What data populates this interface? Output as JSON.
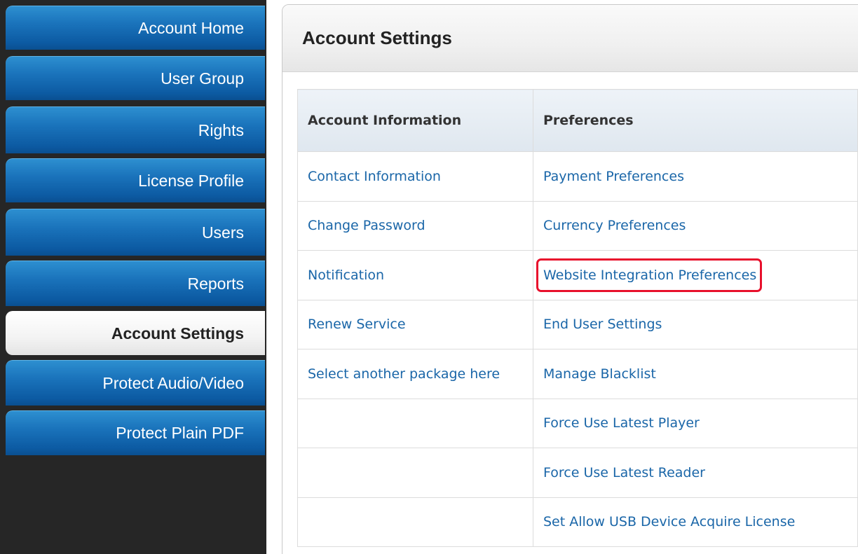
{
  "sidebar": {
    "items": [
      {
        "label": "Account Home",
        "active": false
      },
      {
        "label": "User Group",
        "active": false
      },
      {
        "label": "Rights",
        "active": false
      },
      {
        "label": "License Profile",
        "active": false
      },
      {
        "label": "Users",
        "active": false
      },
      {
        "label": "Reports",
        "active": false
      },
      {
        "label": "Account Settings",
        "active": true
      },
      {
        "label": "Protect Audio/Video",
        "active": false
      },
      {
        "label": "Protect Plain PDF",
        "active": false
      }
    ]
  },
  "main": {
    "title": "Account Settings",
    "table": {
      "headers": [
        "Account Information",
        "Preferences"
      ],
      "account_information": [
        "Contact Information",
        "Change Password",
        "Notification",
        "Renew Service",
        "Select another package here",
        "",
        "",
        ""
      ],
      "preferences": [
        "Payment Preferences",
        "Currency Preferences",
        "Website Integration Preferences",
        "End User Settings",
        "Manage Blacklist",
        "Force Use Latest Player",
        "Force Use Latest Reader",
        "Set Allow USB Device Acquire License"
      ],
      "highlighted": "Website Integration Preferences"
    }
  },
  "colors": {
    "nav_blue": "#1a73bb",
    "sidebar_bg": "#262626",
    "link": "#1a66a8",
    "highlight_border": "#e8102c"
  }
}
